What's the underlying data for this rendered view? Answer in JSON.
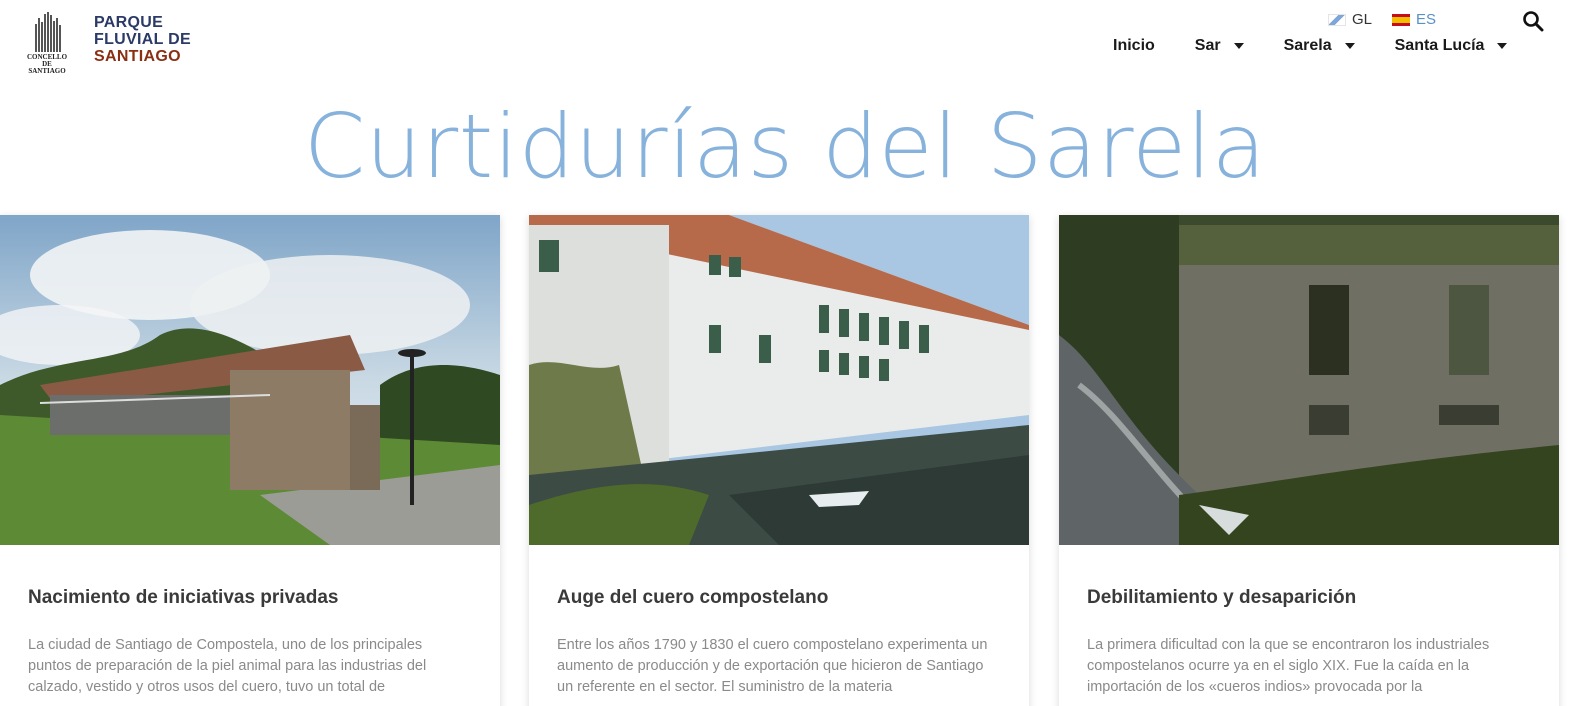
{
  "header": {
    "logo_concello_line1": "CONCELLO DE",
    "logo_concello_line2": "SANTIAGO",
    "logo_parque_line1": "PARQUE",
    "logo_parque_line2": "FLUVIAL DE",
    "logo_parque_line3": "SANTIAGO",
    "languages": [
      {
        "code": "GL",
        "flag": "galicia-flag-icon"
      },
      {
        "code": "ES",
        "flag": "spain-flag-icon"
      }
    ],
    "nav": [
      {
        "label": "Inicio",
        "dropdown": false
      },
      {
        "label": "Sar",
        "dropdown": true
      },
      {
        "label": "Sarela",
        "dropdown": true
      },
      {
        "label": "Santa Lucía",
        "dropdown": true
      }
    ]
  },
  "page": {
    "title": "Curtidurías del Sarela"
  },
  "cards": [
    {
      "title": "Nacimiento de iniciativas privadas",
      "text": "La ciudad de Santiago de Compostela, uno de los principales puntos de preparación de la piel animal para las industrias del calzado, vestido y otros usos del cuero, tuvo un total de"
    },
    {
      "title": "Auge del cuero compostelano",
      "text": "Entre los años 1790 y 1830 el cuero compostelano experimenta un aumento de producción y de exportación que hicieron de Santiago un referente en el sector. El suministro de la materia"
    },
    {
      "title": "Debilitamiento y desaparición",
      "text": "La primera dificultad con la que se encontraron los industriales compostelanos ocurre ya en el siglo XIX. Fue la caída en la importación de los «cueros indios» provocada por la"
    }
  ],
  "colors": {
    "title_blue": "#87b2dc",
    "logo_navy": "#2b3a66",
    "logo_brown": "#8a2f12",
    "lang_active": "#5a8fc8"
  }
}
